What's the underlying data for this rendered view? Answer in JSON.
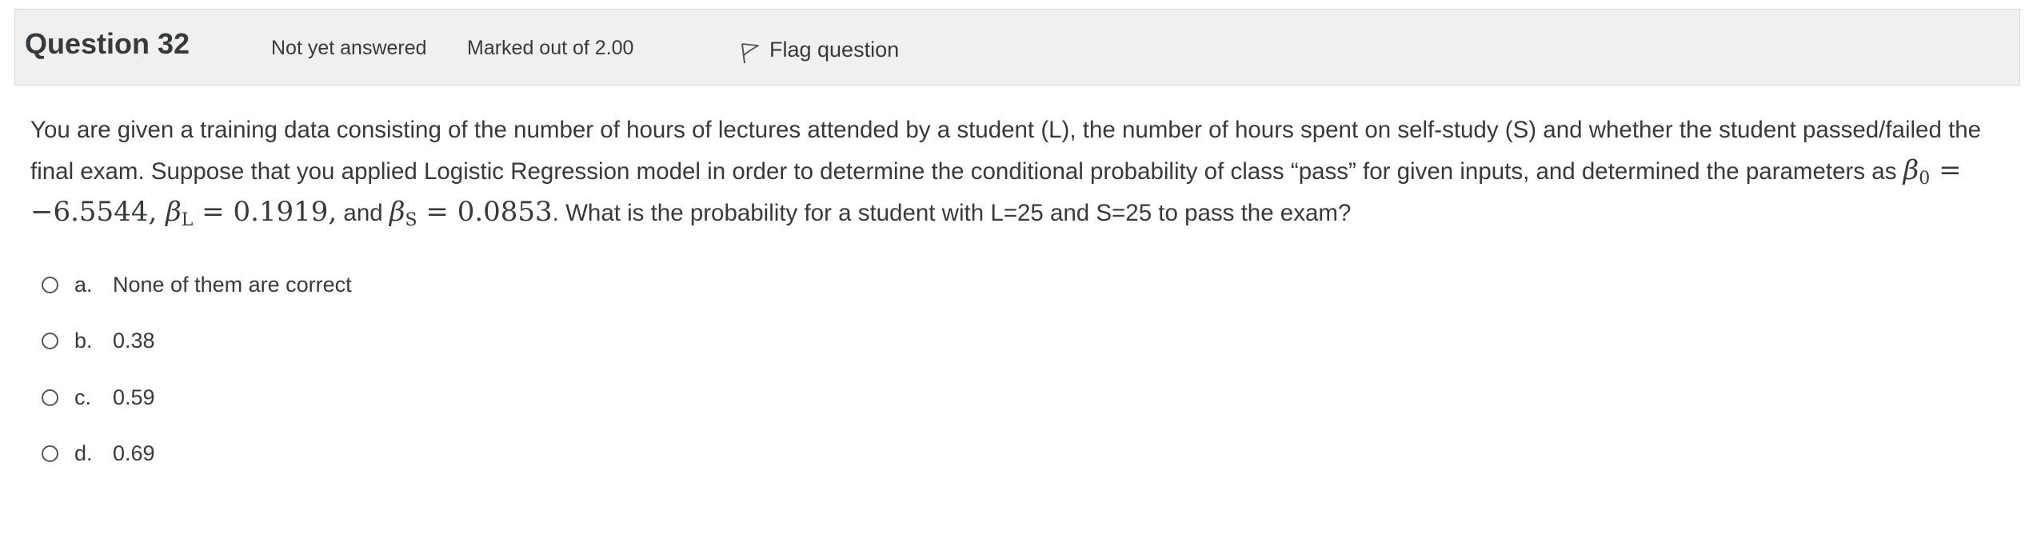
{
  "info": {
    "question_word": "Question",
    "question_number": "32",
    "status": "Not yet answered",
    "grade": "Marked out of 2.00",
    "flag_label": "Flag question",
    "flag_icon": "flag-outline-icon"
  },
  "question": {
    "text_1": "You are given a training data consisting of the number of hours of lectures attended by a student (L), the number of hours spent on self-study (S) and whether the student passed/failed the final exam. Suppose that you applied Logistic Regression model in order to determine the conditional probability of class “pass” for given inputs, and determined the parameters as ",
    "beta0_symbol": "β",
    "beta0_sub": "0",
    "beta0_value": " = −6.5544, ",
    "betaL_symbol": "β",
    "betaL_sub": "L",
    "betaL_value": " = 0.1919,",
    "and_text": " and ",
    "betaS_symbol": "β",
    "betaS_sub": "S",
    "betaS_value": " = 0.0853",
    "text_2": ". What is the probability for a student with L=25 and S=25 to pass the exam?"
  },
  "answers": [
    {
      "letter": "a.",
      "text": "None of them are correct"
    },
    {
      "letter": "b.",
      "text": "0.38"
    },
    {
      "letter": "c.",
      "text": "0.59"
    },
    {
      "letter": "d.",
      "text": "0.69"
    }
  ],
  "colors": {
    "info_bar_background": "#f0f0f0",
    "info_bar_border": "#d9d9d9",
    "text": "#373a3c"
  }
}
